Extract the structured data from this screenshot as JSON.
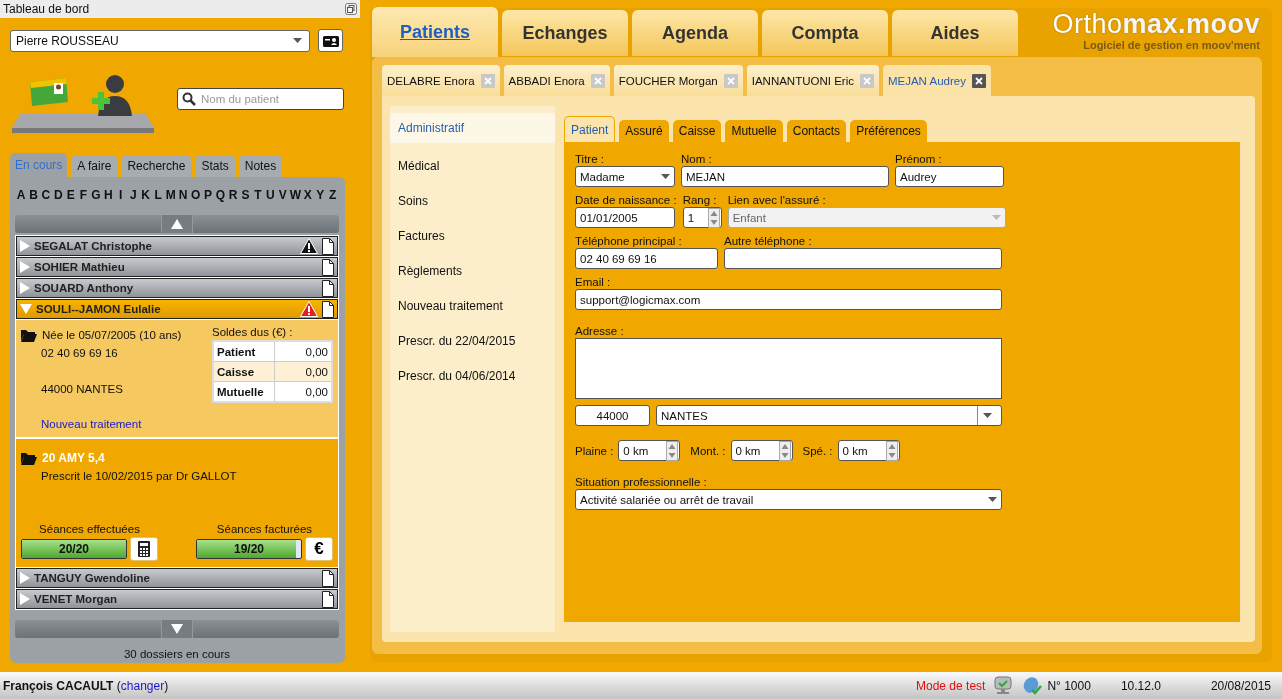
{
  "sidebar": {
    "title": "Tableau de bord",
    "practitioner_select": {
      "value": "Pierre ROUSSEAU"
    },
    "search": {
      "placeholder": "Nom du patient"
    },
    "tabs": [
      {
        "label": "En cours",
        "selected": true
      },
      {
        "label": "A faire",
        "selected": false
      },
      {
        "label": "Recherche",
        "selected": false
      },
      {
        "label": "Stats",
        "selected": false
      },
      {
        "label": "Notes",
        "selected": false
      }
    ],
    "alphabet": [
      "A",
      "B",
      "C",
      "D",
      "E",
      "F",
      "G",
      "H",
      "I",
      "J",
      "K",
      "L",
      "M",
      "N",
      "O",
      "P",
      "Q",
      "R",
      "S",
      "T",
      "U",
      "V",
      "W",
      "X",
      "Y",
      "Z"
    ],
    "patients": [
      {
        "name": "SEGALAT Christophe",
        "expanded": false,
        "warning": true,
        "color": "#111111"
      },
      {
        "name": "SOHIER Mathieu",
        "expanded": false,
        "warning": false
      },
      {
        "name": "SOUARD Anthony",
        "expanded": false,
        "warning": false
      },
      {
        "name": "SOULI--JAMON Eulalie",
        "expanded": true,
        "warning": true,
        "color": "#e02020",
        "details": {
          "birth": "Née le 05/07/2005 (10 ans)",
          "phone": "02 40 69 69 16",
          "city": "44000 NANTES",
          "link": "Nouveau traitement",
          "balances_title": "Soldes dus (€) :",
          "balances": [
            {
              "label": "Patient",
              "value": "0,00"
            },
            {
              "label": "Caisse",
              "value": "0,00"
            },
            {
              "label": "Mutuelle",
              "value": "0,00"
            }
          ],
          "treatment": {
            "title": "20 AMY 5,4",
            "prescription": "Prescrit le 10/02/2015 par Dr GALLOT",
            "counters": [
              {
                "label": "Séances effectuées",
                "reading": "20/20",
                "level": 1,
                "kind": "calculator"
              },
              {
                "label": "Séances facturées",
                "reading": "19/20",
                "level": 0.95,
                "kind": "euro",
                "button_label": "€"
              }
            ]
          }
        }
      },
      {
        "name": "TANGUY Gwendoline",
        "expanded": false,
        "warning": false
      },
      {
        "name": "VENET Morgan",
        "expanded": false,
        "warning": false
      }
    ],
    "footer": "30 dossiers en cours"
  },
  "main": {
    "nav": [
      {
        "label": "Patients",
        "selected": true
      },
      {
        "label": "Echanges",
        "selected": false
      },
      {
        "label": "Agenda",
        "selected": false
      },
      {
        "label": "Compta",
        "selected": false
      },
      {
        "label": "Aides",
        "selected": false
      }
    ],
    "logo": {
      "name": "Ortho**max.moov**",
      "tagline": "Logiciel de gestion en moov'ment"
    },
    "patient_tabs": [
      {
        "label": "DELABRE Enora",
        "selected": false
      },
      {
        "label": "ABBADI Enora",
        "selected": false
      },
      {
        "label": "FOUCHER Morgan",
        "selected": false
      },
      {
        "label": "IANNANTUONI Eric",
        "selected": false
      },
      {
        "label": "MEJAN Audrey",
        "selected": true
      }
    ],
    "menu": [
      {
        "label": "Administratif",
        "selected": true
      },
      {
        "label": "Médical",
        "selected": false
      },
      {
        "label": "Soins",
        "selected": false
      },
      {
        "label": "Factures",
        "selected": false
      },
      {
        "label": "Règlements",
        "selected": false
      },
      {
        "label": "Nouveau traitement",
        "selected": false
      },
      {
        "label": "Prescr. du 22/04/2015",
        "selected": false
      },
      {
        "label": "Prescr. du 04/06/2014",
        "selected": false
      }
    ],
    "subtabs": [
      {
        "label": "Patient",
        "selected": true
      },
      {
        "label": "Assuré",
        "selected": false
      },
      {
        "label": "Caisse",
        "selected": false
      },
      {
        "label": "Mutuelle",
        "selected": false
      },
      {
        "label": "Contacts",
        "selected": false
      },
      {
        "label": "Préférences",
        "selected": false
      }
    ],
    "form": {
      "rows": [
        {
          "kind": "stacked",
          "fields": [
            {
              "label": "Titre :",
              "kind": "select",
              "value": "Madame",
              "disabled": false
            },
            {
              "label": "Nom :",
              "kind": "text",
              "value": "MEJAN",
              "disabled": false
            },
            {
              "label": "Prénom :",
              "kind": "text",
              "value": "Audrey",
              "disabled": false
            }
          ]
        },
        {
          "kind": "stacked",
          "fields": [
            {
              "label": "Date de naissance :",
              "kind": "text",
              "value": "01/01/2005",
              "disabled": false
            },
            {
              "label": "Rang :",
              "kind": "spin",
              "value": "1",
              "disabled": false
            },
            {
              "label": "Lien avec l'assuré :",
              "kind": "select",
              "value": "Enfant",
              "disabled": true
            }
          ]
        },
        {
          "kind": "stacked",
          "fields": [
            {
              "label": "Téléphone principal :",
              "kind": "text",
              "value": "02 40 69 69 16",
              "disabled": false
            },
            {
              "label": "Autre téléphone :",
              "kind": "text",
              "disabled": false
            }
          ]
        },
        {
          "kind": "stacked",
          "fields": [
            {
              "label": "Email :",
              "kind": "text",
              "value": "support@logicmax.com",
              "disabled": false
            }
          ]
        },
        {
          "kind": "stacked",
          "fields": [
            {
              "label": "Adresse :",
              "kind": "textarea",
              "disabled": false
            }
          ]
        },
        {
          "kind": "stacked",
          "fields": [
            {
              "kind": "text",
              "value": "44000",
              "disabled": false
            },
            {
              "kind": "select",
              "value": "NANTES",
              "disabled": false
            }
          ]
        },
        {
          "kind": "inline",
          "fields": [
            {
              "label": "Plaine :",
              "kind": "spin",
              "value": "0 km",
              "disabled": false
            },
            {
              "label": "Mont. :",
              "kind": "spin",
              "value": "0 km",
              "disabled": false
            },
            {
              "label": "Spé. :",
              "kind": "spin",
              "value": "0 km",
              "disabled": false
            }
          ]
        },
        {
          "kind": "stacked",
          "fields": [
            {
              "label": "Situation professionnelle :",
              "kind": "select",
              "value": "Activité salariée ou arrêt de travail",
              "disabled": false
            }
          ]
        }
      ]
    }
  },
  "status_bar": {
    "user_line": {
      "before": "**François CACAULT** (",
      "link": "changer",
      "after": ")"
    },
    "mode": "Mode de test",
    "number": "N° 1000",
    "version": "10.12.0",
    "date": "20/08/2015"
  }
}
